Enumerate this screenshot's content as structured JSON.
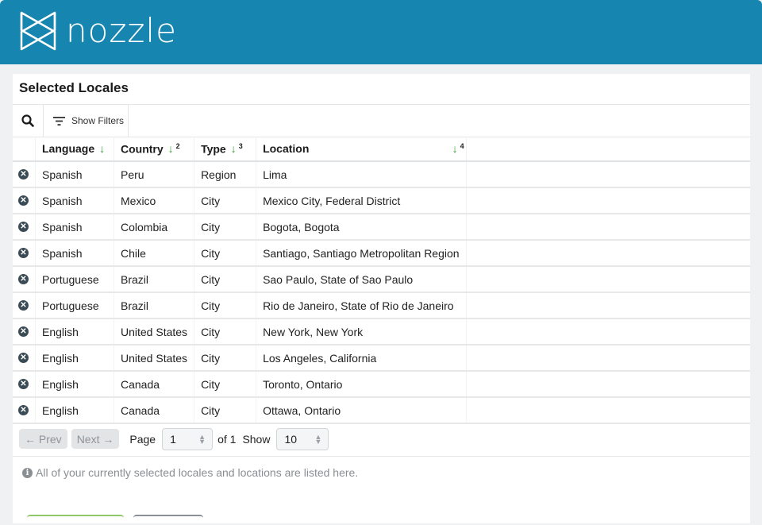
{
  "header": {
    "brand": "nozzle",
    "brand_color": "#1686b0"
  },
  "panel": {
    "title": "Selected Locales"
  },
  "toolbar": {
    "search_icon": "search-icon",
    "filters_label": "Show Filters",
    "filters_icon": "filter-icon"
  },
  "table": {
    "columns": [
      {
        "label": "Language",
        "sort": "desc",
        "sort_order": null
      },
      {
        "label": "Country",
        "sort": "desc",
        "sort_order": "2"
      },
      {
        "label": "Type",
        "sort": "desc",
        "sort_order": "3"
      },
      {
        "label": "Location",
        "sort": "desc",
        "sort_order": "4"
      }
    ],
    "rows": [
      {
        "language": "Spanish",
        "country": "Peru",
        "type": "Region",
        "location": "Lima"
      },
      {
        "language": "Spanish",
        "country": "Mexico",
        "type": "City",
        "location": "Mexico City, Federal District"
      },
      {
        "language": "Spanish",
        "country": "Colombia",
        "type": "City",
        "location": "Bogota, Bogota"
      },
      {
        "language": "Spanish",
        "country": "Chile",
        "type": "City",
        "location": "Santiago, Santiago Metropolitan Region"
      },
      {
        "language": "Portuguese",
        "country": "Brazil",
        "type": "City",
        "location": "Sao Paulo, State of Sao Paulo"
      },
      {
        "language": "Portuguese",
        "country": "Brazil",
        "type": "City",
        "location": "Rio de Janeiro, State of Rio de Janeiro"
      },
      {
        "language": "English",
        "country": "United States",
        "type": "City",
        "location": "New York, New York"
      },
      {
        "language": "English",
        "country": "United States",
        "type": "City",
        "location": "Los Angeles, California"
      },
      {
        "language": "English",
        "country": "Canada",
        "type": "City",
        "location": "Toronto, Ontario"
      },
      {
        "language": "English",
        "country": "Canada",
        "type": "City",
        "location": "Ottawa, Ontario"
      }
    ],
    "sort_arrow": "↓",
    "remove_glyph": "✕"
  },
  "pager": {
    "prev_label": "← Prev",
    "next_label": "Next →",
    "page_label": "Page",
    "page_value": "1",
    "of_label": "of 1",
    "show_label": "Show",
    "show_value": "10"
  },
  "info": {
    "icon": "i",
    "text": "All of your currently selected locales and locations are listed here."
  },
  "colors": {
    "sort_arrow": "#3a9b34",
    "remove_icon": "#3b4b55"
  }
}
